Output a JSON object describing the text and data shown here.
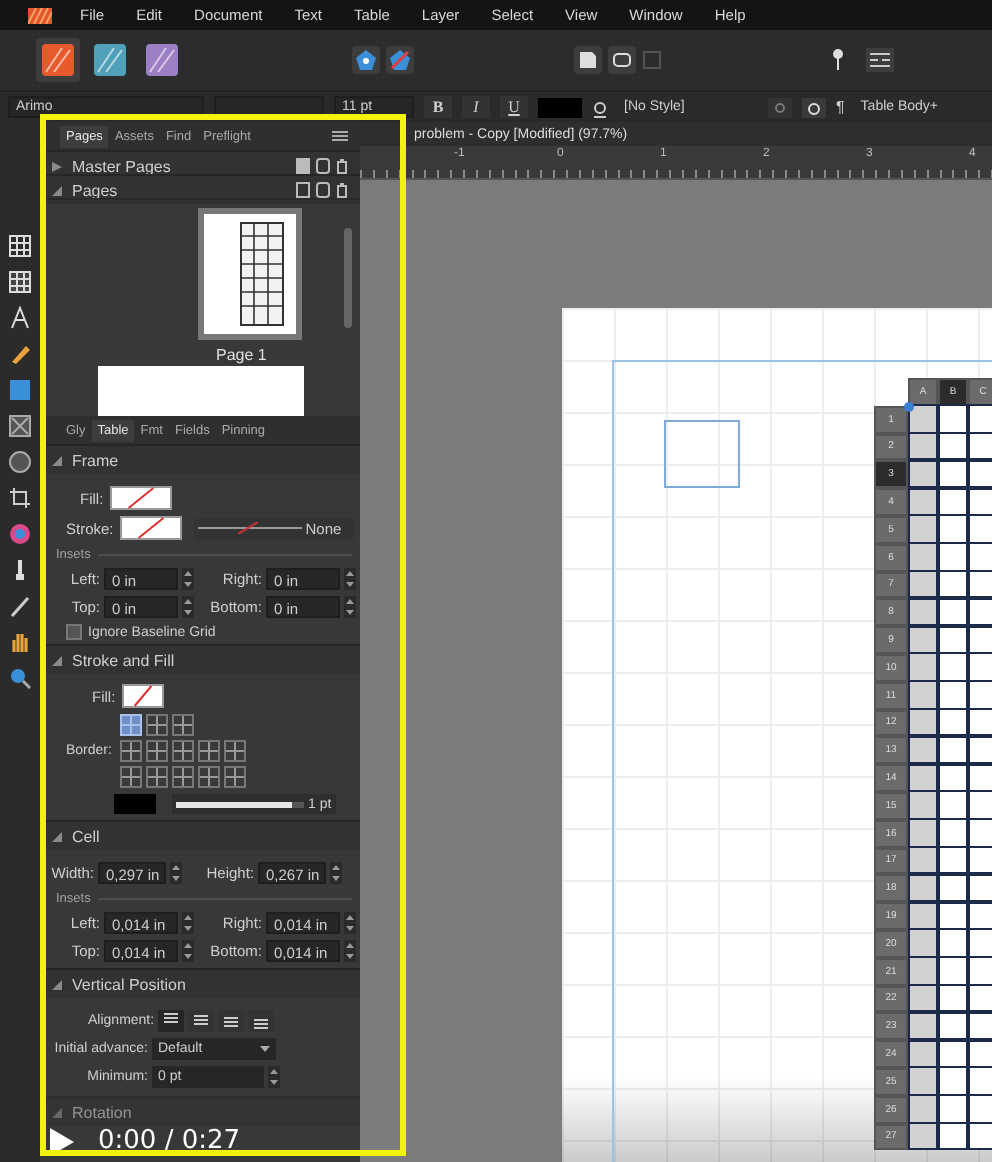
{
  "menu_bar": {
    "items": [
      "File",
      "Edit",
      "Document",
      "Text",
      "Table",
      "Layer",
      "Select",
      "View",
      "Window",
      "Help"
    ]
  },
  "personas": [
    {
      "selected": true
    },
    {
      "selected": false
    },
    {
      "selected": false
    }
  ],
  "context_bar": {
    "font": "Arimo",
    "size": "11 pt",
    "text_styles": [
      "B",
      "I",
      "U"
    ],
    "paragraph_style": "[No Style]",
    "pilcrow": "¶",
    "table_style": "Table Body+"
  },
  "panel": {
    "tabs": [
      {
        "label": "Pages",
        "selected": true
      },
      {
        "label": "Assets",
        "selected": false
      },
      {
        "label": "Find",
        "selected": false
      },
      {
        "label": "Preflight",
        "selected": false
      }
    ],
    "sections": [
      {
        "title": "Master Pages",
        "expanded": false
      },
      {
        "title": "Pages",
        "expanded": true
      }
    ],
    "page_label": "Page 1"
  },
  "inspector": {
    "tabs": [
      {
        "label": "Gly",
        "selected": false
      },
      {
        "label": "Table",
        "selected": true
      },
      {
        "label": "Fmt",
        "selected": false
      },
      {
        "label": "Fields",
        "selected": false
      },
      {
        "label": "Pinning",
        "selected": false
      }
    ]
  },
  "frame": {
    "title": "Frame",
    "expanded": true,
    "fill_label": "Fill:",
    "stroke_label": "Stroke:",
    "stroke_style": "None",
    "insets_label": "Insets",
    "insets": [
      {
        "label": "Left:",
        "value": "0 in"
      },
      {
        "label": "Right:",
        "value": "0 in"
      },
      {
        "label": "Top:",
        "value": "0 in"
      },
      {
        "label": "Bottom:",
        "value": "0 in"
      }
    ],
    "baseline_grid": {
      "label": "Ignore Baseline Grid",
      "checked": false
    }
  },
  "stroke_and_fill": {
    "title": "Stroke and Fill",
    "expanded": true,
    "fill_label": "Fill:",
    "border_label": "Border:",
    "border_presets": [
      {
        "selected": true
      },
      {
        "selected": false
      },
      {
        "selected": false
      }
    ],
    "stroke_width": {
      "level": 0.9,
      "reading": "1 pt"
    }
  },
  "cell": {
    "title": "Cell",
    "expanded": true,
    "size": [
      {
        "label": "Width:",
        "value": "0,297 in"
      },
      {
        "label": "Height:",
        "value": "0,267 in"
      }
    ],
    "insets_label": "Insets",
    "insets": [
      {
        "label": "Left:",
        "value": "0,014 in"
      },
      {
        "label": "Right:",
        "value": "0,014 in"
      },
      {
        "label": "Top:",
        "value": "0,014 in"
      },
      {
        "label": "Bottom:",
        "value": "0,014 in"
      }
    ]
  },
  "vertical_position": {
    "title": "Vertical Position",
    "expanded": true,
    "alignment_label": "Alignment:",
    "alignments": [
      {
        "selected": true
      },
      {
        "selected": false
      },
      {
        "selected": false
      },
      {
        "selected": false
      }
    ],
    "initial_advance": {
      "label": "Initial advance:",
      "value": "Default"
    },
    "minimum": {
      "label": "Minimum:",
      "value": "0 pt"
    }
  },
  "rotation": {
    "title": "Rotation",
    "expanded": true
  },
  "document": {
    "title": "problem - Copy [Modified] (97.7%)",
    "ruler_labels": [
      "-1",
      "0",
      "1",
      "2",
      "3",
      "4"
    ]
  },
  "table": {
    "columns": [
      {
        "label": "A",
        "selected": false
      },
      {
        "label": "B",
        "selected": true
      },
      {
        "label": "C",
        "selected": false
      }
    ],
    "rows": [
      {
        "label": "1",
        "selected": false
      },
      {
        "label": "2",
        "selected": false
      },
      {
        "label": "3",
        "selected": true
      },
      {
        "label": "4",
        "selected": false
      },
      {
        "label": "5",
        "selected": false
      },
      {
        "label": "6",
        "selected": false
      },
      {
        "label": "7",
        "selected": false
      },
      {
        "label": "8",
        "selected": false
      },
      {
        "label": "9",
        "selected": false
      },
      {
        "label": "10",
        "selected": false
      },
      {
        "label": "11",
        "selected": false
      },
      {
        "label": "12",
        "selected": false
      },
      {
        "label": "13",
        "selected": false
      },
      {
        "label": "14",
        "selected": false
      },
      {
        "label": "15",
        "selected": false
      },
      {
        "label": "16",
        "selected": false
      },
      {
        "label": "17",
        "selected": false
      },
      {
        "label": "18",
        "selected": false
      },
      {
        "label": "19",
        "selected": false
      },
      {
        "label": "20",
        "selected": false
      },
      {
        "label": "21",
        "selected": false
      },
      {
        "label": "22",
        "selected": false
      },
      {
        "label": "23",
        "selected": false
      },
      {
        "label": "24",
        "selected": false
      },
      {
        "label": "25",
        "selected": false
      },
      {
        "label": "26",
        "selected": false
      },
      {
        "label": "27",
        "selected": false
      }
    ]
  },
  "video": {
    "time": "0:00 / 0:27"
  }
}
